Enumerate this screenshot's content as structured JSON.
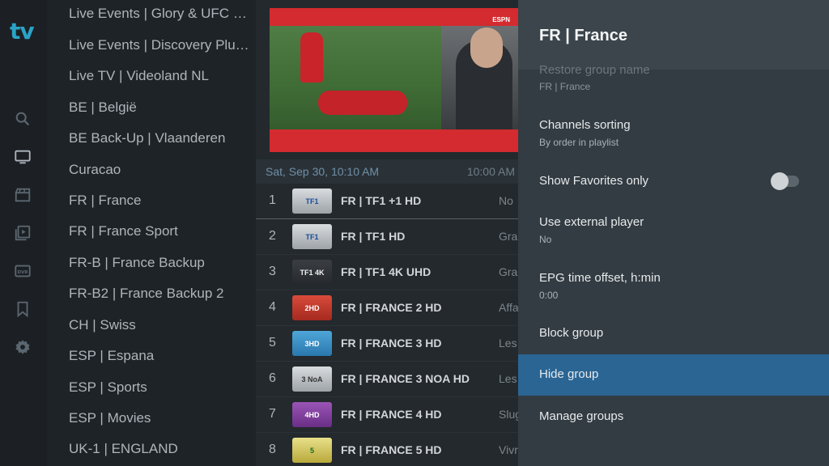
{
  "app": {
    "logo": "tv"
  },
  "nav": [
    {
      "icon": "search-icon"
    },
    {
      "icon": "tv-icon"
    },
    {
      "icon": "movie-clapper-icon"
    },
    {
      "icon": "series-play-icon"
    },
    {
      "icon": "dvr-icon"
    },
    {
      "icon": "bookmark-icon"
    },
    {
      "icon": "gear-icon"
    }
  ],
  "groups": [
    "Live Events | Glory & UFC an...",
    "Live Events | Discovery Plus...",
    "Live TV | Videoland NL",
    "BE | België",
    "BE Back-Up | Vlaanderen",
    "Curacao",
    "FR | France",
    "FR | France Sport",
    "FR-B | France Backup",
    "FR-B2 | France Backup 2",
    "CH | Swiss",
    "ESP | Espana",
    "ESP | Sports",
    "ESP | Movies",
    "UK-1 | ENGLAND"
  ],
  "preview": {
    "watermark": "ESPN"
  },
  "epg": {
    "date": "Sat, Sep 30, 10:10 AM",
    "time": "10:00 AM"
  },
  "channels": [
    {
      "num": "1",
      "logo": "TF1",
      "name": "FR | TF1 +1 HD",
      "prog": "No"
    },
    {
      "num": "2",
      "logo": "TF1",
      "name": "FR | TF1 HD",
      "prog": "Gra"
    },
    {
      "num": "3",
      "logo": "TF1 4K",
      "name": "FR | TF1 4K UHD",
      "prog": "Gra"
    },
    {
      "num": "4",
      "logo": "2HD",
      "name": "FR | FRANCE 2 HD",
      "prog": "Affa"
    },
    {
      "num": "5",
      "logo": "3HD",
      "name": "FR | FRANCE 3 HD",
      "prog": "Les"
    },
    {
      "num": "6",
      "logo": "3 NoA",
      "name": "FR | FRANCE 3 NOA HD",
      "prog": "Les"
    },
    {
      "num": "7",
      "logo": "4HD",
      "name": "FR | FRANCE 4 HD",
      "prog": "Slug"
    },
    {
      "num": "8",
      "logo": "5",
      "name": "FR | FRANCE 5 HD",
      "prog": "Vivr"
    }
  ],
  "panel": {
    "title": "FR | France",
    "options": [
      {
        "label": "Restore group name",
        "sub": "FR | France"
      },
      {
        "label": "Channels sorting",
        "sub": "By order in playlist"
      },
      {
        "label": "Show Favorites only",
        "sub": ""
      },
      {
        "label": "Use external player",
        "sub": "No"
      },
      {
        "label": "EPG time offset, h:min",
        "sub": "0:00"
      },
      {
        "label": "Block group",
        "sub": ""
      },
      {
        "label": "Hide group",
        "sub": ""
      },
      {
        "label": "Manage groups",
        "sub": ""
      }
    ],
    "favorites_toggle_on": false
  },
  "colors": {
    "accent": "#2aa3c7",
    "selected": "#2a6594",
    "panel": "#333c42"
  }
}
